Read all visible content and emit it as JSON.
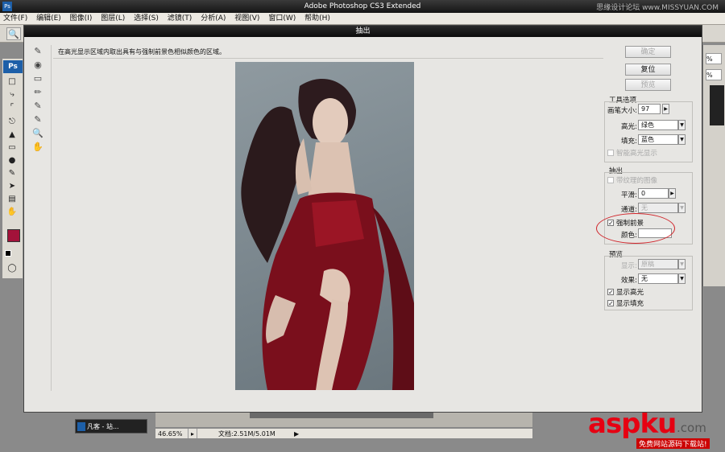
{
  "app": {
    "title": "Adobe Photoshop CS3 Extended",
    "ps_icon": "Ps",
    "site_watermark": "思缘设计论坛 www.MISSYUAN.COM"
  },
  "menu": [
    "文件(F)",
    "编辑(E)",
    "图像(I)",
    "图层(L)",
    "选择(S)",
    "滤镜(T)",
    "分析(A)",
    "视图(V)",
    "窗口(W)",
    "帮助(H)"
  ],
  "dialog": {
    "title": "抽出",
    "hint": "在高光显示区域内取出具有与强制前景色相似颜色的区域。",
    "buttons": {
      "ok": "确定",
      "reset": "复位",
      "preview": "预览"
    },
    "tool_options": {
      "title": "工具选项",
      "brush_size_label": "画笔大小:",
      "brush_size": "97",
      "highlight_label": "高光:",
      "highlight_value": "绿色",
      "fill_label": "填充:",
      "fill_value": "蓝色",
      "smart_highlight": "智能高光显示"
    },
    "extract": {
      "title": "抽出",
      "textured": "带纹理的图像",
      "smooth_label": "平滑:",
      "smooth_value": "0",
      "channel_label": "通道:",
      "channel_value": "无",
      "force_fg": "强制前景",
      "force_fg_checked": true,
      "color_label": "颜色:"
    },
    "preview_group": {
      "title": "预览",
      "show_label": "显示:",
      "show_value": "原稿",
      "effect_label": "效果:",
      "effect_value": "无",
      "show_highlight": "显示高光",
      "show_fill": "显示填充"
    }
  },
  "status": {
    "zoom": "46.65%",
    "doc": "文档:2.51M/5.01M"
  },
  "taskbar": {
    "window_label": "凡客 - 站..."
  },
  "brand": {
    "logo": "aspku",
    "domain": ".com",
    "slogan": "免费网站源码下载站!"
  },
  "colors": {
    "foreground": "#a3123a",
    "annotation": "#d0242a",
    "brand": "#e60012"
  }
}
